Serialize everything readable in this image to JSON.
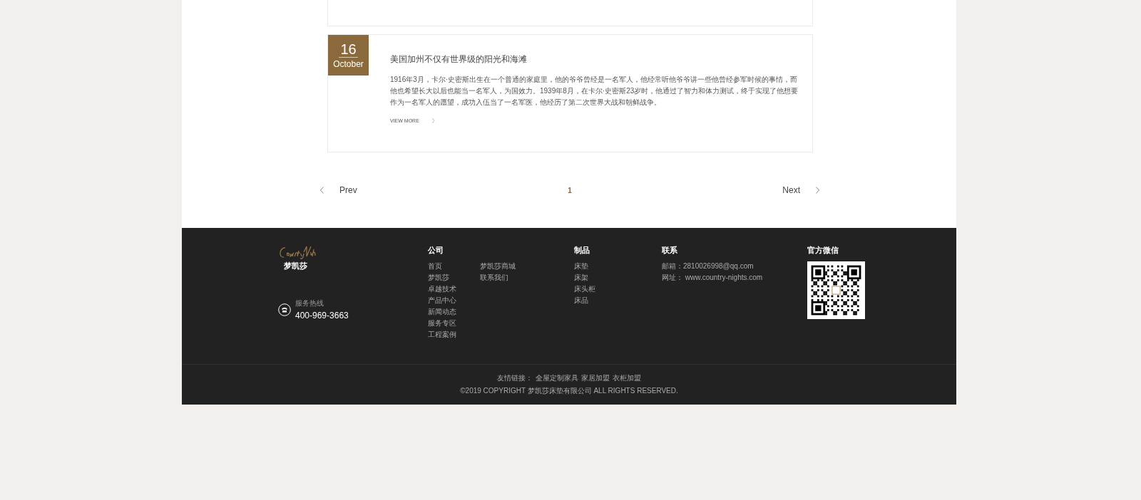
{
  "articles": [
    {
      "day": "16",
      "month": "October",
      "title": "美国加州不仅有世界级的阳光和海滩",
      "body": "1916年3月，卡尔·史密斯出生在一个普通的家庭里，他的爷爷曾经是一名军人，他经常听他爷爷讲一些他曾经参军时候的事情，而他也希望长大以后也能当一名军人，为国效力。1939年8月，在卡尔·史密斯23岁时，他通过了智力和体力测试，终于实现了他想要作为一名军人的愿望，成功入伍当了一名军医，他经历了第二次世界大战和朝鲜战争。",
      "more": "VIEW MORE"
    }
  ],
  "pagination": {
    "prev": "Prev",
    "next": "Next",
    "pages": [
      {
        "label": "1",
        "selected": true
      }
    ]
  },
  "footer": {
    "brand": "梦凯莎",
    "hotline_label": "服务热线",
    "hotline": "400-969-3663",
    "columns": [
      {
        "title": "公司",
        "kind": "links",
        "links": [
          "首页",
          "梦凯莎",
          "卓越技术",
          "产品中心",
          "新闻动态",
          "服务专区",
          "工程案例",
          "梦凯莎商城",
          "联系我们"
        ]
      },
      {
        "title": "制品",
        "kind": "links",
        "links": [
          "床垫",
          "床架",
          "床头柜",
          "床品"
        ]
      },
      {
        "title": "联系",
        "kind": "contact",
        "links": [
          "邮箱：2810026998@qq.com",
          "网址： www.country-nights.com"
        ]
      },
      {
        "title": "官方微信",
        "kind": "qr"
      }
    ],
    "friend_label": "友情链接：",
    "friend_links": [
      "全屋定制家具",
      "家居加盟",
      "衣柜加盟"
    ],
    "copyright": "©2019 COPYRIGHT 梦凯莎床垫有限公司 ALL RIGHTS RESERVED."
  }
}
